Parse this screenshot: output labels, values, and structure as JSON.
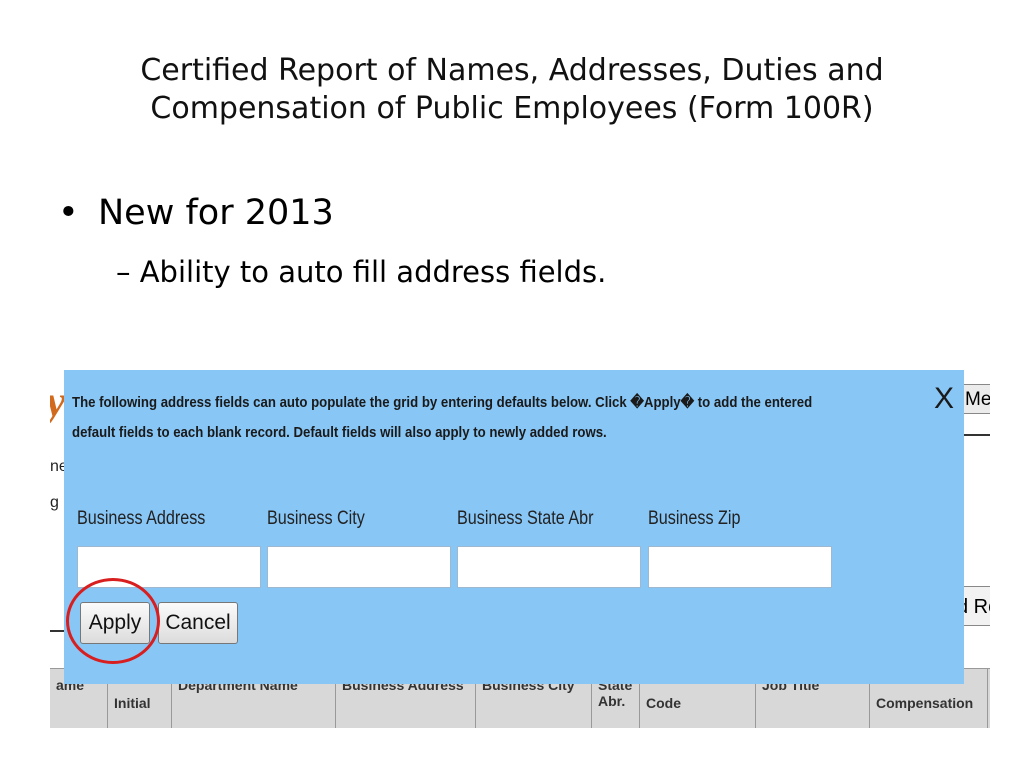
{
  "slide": {
    "title_line1": "Certified Report of Names, Addresses, Duties and",
    "title_line2": "Compensation of Public Employees (Form 100R)",
    "bullet_symbol": "•",
    "bullet1": "New for 2013",
    "bullet2": "– Ability to auto fill address fields."
  },
  "background_app": {
    "logo_fragment": "y",
    "text_fragment_1": "ne",
    "text_fragment_2": "g",
    "menu_button_fragment": "Me",
    "add_row_button_fragment": "d Ro",
    "grid_headers": [
      "ame",
      "Initial",
      "Department Name",
      "Business Address",
      "Business City",
      "State Abr.",
      "Code",
      "Job Title",
      "Compensation"
    ]
  },
  "popup": {
    "message_line1": "The following address fields can auto populate the grid by entering defaults below. Click �Apply� to add the entered",
    "message_line2": "default fields to each blank record. Default fields will also apply to newly added rows.",
    "close_label": "X",
    "fields": [
      {
        "label": "Business Address",
        "value": ""
      },
      {
        "label": "Business City",
        "value": ""
      },
      {
        "label": "Business State Abr",
        "value": ""
      },
      {
        "label": "Business Zip",
        "value": ""
      }
    ],
    "apply_label": "Apply",
    "cancel_label": "Cancel"
  },
  "colors": {
    "popup_bg": "#88c6f6",
    "highlight_circle": "#d81e1e",
    "logo_orange": "#d26a1d"
  }
}
